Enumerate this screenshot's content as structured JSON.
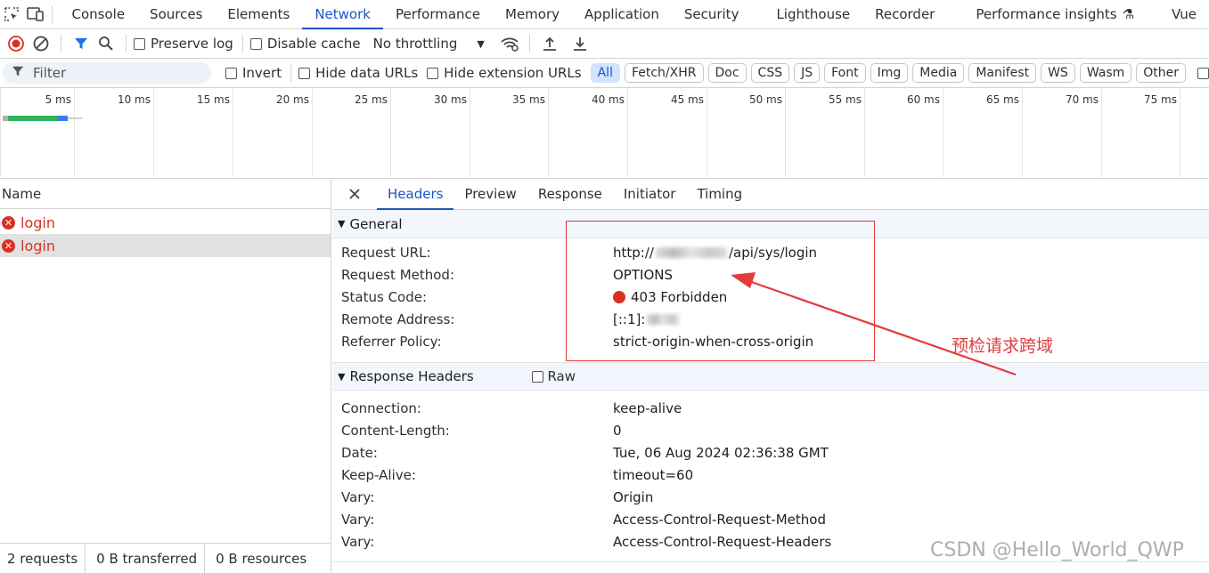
{
  "tabs": [
    "Console",
    "Sources",
    "Elements",
    "Network",
    "Performance",
    "Memory",
    "Application",
    "Security",
    "Lighthouse",
    "Recorder",
    "Performance insights",
    "Vue"
  ],
  "toolbar": {
    "preserve_log": "Preserve log",
    "disable_cache": "Disable cache",
    "throttling": "No throttling"
  },
  "filter": {
    "placeholder": "Filter",
    "invert": "Invert",
    "hide_data_urls": "Hide data URLs",
    "hide_extension_urls": "Hide extension URLs",
    "types": [
      "All",
      "Fetch/XHR",
      "Doc",
      "CSS",
      "JS",
      "Font",
      "Img",
      "Media",
      "Manifest",
      "WS",
      "Wasm",
      "Other"
    ]
  },
  "timeline": {
    "ticks": [
      "5 ms",
      "10 ms",
      "15 ms",
      "20 ms",
      "25 ms",
      "30 ms",
      "35 ms",
      "40 ms",
      "45 ms",
      "50 ms",
      "55 ms",
      "60 ms",
      "65 ms",
      "70 ms",
      "75 ms"
    ]
  },
  "requests": {
    "header": "Name",
    "items": [
      "login",
      "login"
    ]
  },
  "status": {
    "requests": "2 requests",
    "transferred": "0 B transferred",
    "resources": "0 B resources"
  },
  "detail": {
    "tabs": [
      "Headers",
      "Preview",
      "Response",
      "Initiator",
      "Timing"
    ],
    "general": {
      "title": "General",
      "request_url_label": "Request URL:",
      "request_url_prefix": "http://",
      "request_url_suffix": "/api/sys/login",
      "request_method_label": "Request Method:",
      "request_method": "OPTIONS",
      "status_code_label": "Status Code:",
      "status_code": "403 Forbidden",
      "remote_address_label": "Remote Address:",
      "remote_address_prefix": "[::1]:",
      "referrer_policy_label": "Referrer Policy:",
      "referrer_policy": "strict-origin-when-cross-origin"
    },
    "response_headers": {
      "title": "Response Headers",
      "raw": "Raw",
      "rows": [
        {
          "k": "Connection:",
          "v": "keep-alive"
        },
        {
          "k": "Content-Length:",
          "v": "0"
        },
        {
          "k": "Date:",
          "v": "Tue, 06 Aug 2024 02:36:38 GMT"
        },
        {
          "k": "Keep-Alive:",
          "v": "timeout=60"
        },
        {
          "k": "Vary:",
          "v": "Origin"
        },
        {
          "k": "Vary:",
          "v": "Access-Control-Request-Method"
        },
        {
          "k": "Vary:",
          "v": "Access-Control-Request-Headers"
        }
      ]
    }
  },
  "annotation": {
    "text": "预检请求跨域",
    "color": "#e23b3b"
  },
  "watermark": "CSDN @Hello_World_QWP"
}
